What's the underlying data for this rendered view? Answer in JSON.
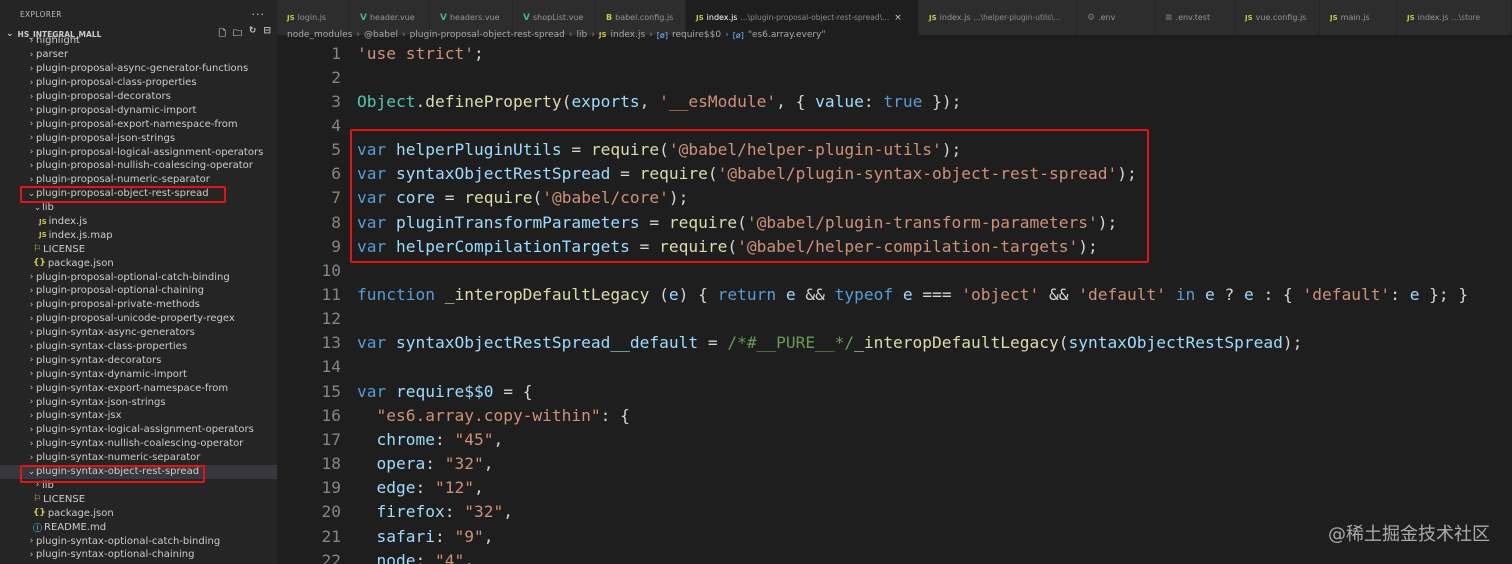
{
  "sidebar": {
    "title": "EXPLORER",
    "more": "···",
    "project": "HS_INTEGRAL_MALL",
    "items": [
      {
        "label": "highlight",
        "indent": 1,
        "chev": "›"
      },
      {
        "label": "parser",
        "indent": 1,
        "chev": "›"
      },
      {
        "label": "plugin-proposal-async-generator-functions",
        "indent": 1,
        "chev": "›"
      },
      {
        "label": "plugin-proposal-class-properties",
        "indent": 1,
        "chev": "›"
      },
      {
        "label": "plugin-proposal-decorators",
        "indent": 1,
        "chev": "›"
      },
      {
        "label": "plugin-proposal-dynamic-import",
        "indent": 1,
        "chev": "›"
      },
      {
        "label": "plugin-proposal-export-namespace-from",
        "indent": 1,
        "chev": "›"
      },
      {
        "label": "plugin-proposal-json-strings",
        "indent": 1,
        "chev": "›"
      },
      {
        "label": "plugin-proposal-logical-assignment-operators",
        "indent": 1,
        "chev": "›"
      },
      {
        "label": "plugin-proposal-nullish-coalescing-operator",
        "indent": 1,
        "chev": "›"
      },
      {
        "label": "plugin-proposal-numeric-separator",
        "indent": 1,
        "chev": "›"
      },
      {
        "label": "plugin-proposal-object-rest-spread",
        "indent": 1,
        "chev": "⌄"
      },
      {
        "label": "lib",
        "indent": 2,
        "chev": "⌄"
      },
      {
        "label": "index.js",
        "indent": 3,
        "icon": "JS"
      },
      {
        "label": "index.js.map",
        "indent": 3,
        "icon": "JS"
      },
      {
        "label": "LICENSE",
        "indent": 2,
        "icon": "LIC"
      },
      {
        "label": "package.json",
        "indent": 2,
        "icon": "JSON"
      },
      {
        "label": "plugin-proposal-optional-catch-binding",
        "indent": 1,
        "chev": "›"
      },
      {
        "label": "plugin-proposal-optional-chaining",
        "indent": 1,
        "chev": "›"
      },
      {
        "label": "plugin-proposal-private-methods",
        "indent": 1,
        "chev": "›"
      },
      {
        "label": "plugin-proposal-unicode-property-regex",
        "indent": 1,
        "chev": "›"
      },
      {
        "label": "plugin-syntax-async-generators",
        "indent": 1,
        "chev": "›"
      },
      {
        "label": "plugin-syntax-class-properties",
        "indent": 1,
        "chev": "›"
      },
      {
        "label": "plugin-syntax-decorators",
        "indent": 1,
        "chev": "›"
      },
      {
        "label": "plugin-syntax-dynamic-import",
        "indent": 1,
        "chev": "›"
      },
      {
        "label": "plugin-syntax-export-namespace-from",
        "indent": 1,
        "chev": "›"
      },
      {
        "label": "plugin-syntax-json-strings",
        "indent": 1,
        "chev": "›"
      },
      {
        "label": "plugin-syntax-jsx",
        "indent": 1,
        "chev": "›"
      },
      {
        "label": "plugin-syntax-logical-assignment-operators",
        "indent": 1,
        "chev": "›"
      },
      {
        "label": "plugin-syntax-nullish-coalescing-operator",
        "indent": 1,
        "chev": "›"
      },
      {
        "label": "plugin-syntax-numeric-separator",
        "indent": 1,
        "chev": "›"
      },
      {
        "label": "plugin-syntax-object-rest-spread",
        "indent": 1,
        "chev": "⌄",
        "selected": true
      },
      {
        "label": "lib",
        "indent": 2,
        "chev": "›"
      },
      {
        "label": "LICENSE",
        "indent": 2,
        "icon": "LIC"
      },
      {
        "label": "package.json",
        "indent": 2,
        "icon": "JSON"
      },
      {
        "label": "README.md",
        "indent": 2,
        "icon": "INFO"
      },
      {
        "label": "plugin-syntax-optional-catch-binding",
        "indent": 1,
        "chev": "›"
      },
      {
        "label": "plugin-syntax-optional-chaining",
        "indent": 1,
        "chev": "›"
      }
    ]
  },
  "tabs": [
    {
      "label": "login.js",
      "icon": "JS",
      "width": 73
    },
    {
      "label": "header.vue",
      "icon": "V",
      "width": 80
    },
    {
      "label": "headers.vue",
      "icon": "V",
      "width": 83
    },
    {
      "label": "shopList.vue",
      "icon": "V",
      "width": 83
    },
    {
      "label": "babel.config.js",
      "icon": "B",
      "width": 90
    },
    {
      "label": "index.js",
      "desc": "...\\plugin-proposal-object-rest-spread\\...",
      "icon": "JS",
      "active": true,
      "close": "×",
      "width": 233
    },
    {
      "label": "index.js",
      "desc": "...\\helper-plugin-utils\\...",
      "icon": "JS",
      "width": 158
    },
    {
      "label": ".env",
      "icon": "⚙",
      "width": 78
    },
    {
      "label": ".env.test",
      "icon": "≡",
      "width": 80
    },
    {
      "label": "vue.config.js",
      "icon": "JS",
      "width": 85
    },
    {
      "label": "main.js",
      "icon": "JS",
      "width": 77
    },
    {
      "label": "index.js",
      "desc": "...\\store",
      "icon": "JS",
      "width": 115
    }
  ],
  "breadcrumb": [
    "node_modules",
    "@babel",
    "plugin-proposal-object-rest-spread",
    "lib",
    "index.js",
    "require$$0",
    "\"es6.array.every\""
  ],
  "breadcrumb_icons": {
    "file": "JS",
    "symbol": "[ø]"
  },
  "watermark": "@稀土掘金技术社区",
  "code_lines": [
    {
      "n": "1",
      "tokens": [
        [
          "str",
          "'use strict'"
        ],
        [
          "",
          ";"
        ]
      ]
    },
    {
      "n": "2",
      "tokens": []
    },
    {
      "n": "3",
      "tokens": [
        [
          "cls",
          "Object"
        ],
        [
          "",
          "."
        ],
        [
          "fn",
          "defineProperty"
        ],
        [
          "",
          "("
        ],
        [
          "var",
          "exports"
        ],
        [
          "",
          ", "
        ],
        [
          "str",
          "'__esModule'"
        ],
        [
          "",
          ", { "
        ],
        [
          "var",
          "value"
        ],
        [
          "",
          ": "
        ],
        [
          "kw",
          "true"
        ],
        [
          "",
          " });"
        ]
      ]
    },
    {
      "n": "4",
      "tokens": []
    },
    {
      "n": "5",
      "tokens": [
        [
          "kw",
          "var"
        ],
        [
          "",
          " "
        ],
        [
          "var",
          "helperPluginUtils"
        ],
        [
          "",
          " = "
        ],
        [
          "fn",
          "require"
        ],
        [
          "",
          "("
        ],
        [
          "str",
          "'@babel/helper-plugin-utils'"
        ],
        [
          "",
          ");"
        ]
      ]
    },
    {
      "n": "6",
      "tokens": [
        [
          "kw",
          "var"
        ],
        [
          "",
          " "
        ],
        [
          "var",
          "syntaxObjectRestSpread"
        ],
        [
          "",
          " = "
        ],
        [
          "fn",
          "require"
        ],
        [
          "",
          "("
        ],
        [
          "str",
          "'@babel/plugin-syntax-object-rest-spread'"
        ],
        [
          "",
          ");"
        ]
      ]
    },
    {
      "n": "7",
      "tokens": [
        [
          "kw",
          "var"
        ],
        [
          "",
          " "
        ],
        [
          "var",
          "core"
        ],
        [
          "",
          " = "
        ],
        [
          "fn",
          "require"
        ],
        [
          "",
          "("
        ],
        [
          "str",
          "'@babel/core'"
        ],
        [
          "",
          ");"
        ]
      ]
    },
    {
      "n": "8",
      "tokens": [
        [
          "kw",
          "var"
        ],
        [
          "",
          " "
        ],
        [
          "var",
          "pluginTransformParameters"
        ],
        [
          "",
          " = "
        ],
        [
          "fn",
          "require"
        ],
        [
          "",
          "("
        ],
        [
          "str",
          "'@babel/plugin-transform-parameters'"
        ],
        [
          "",
          ");"
        ]
      ]
    },
    {
      "n": "9",
      "tokens": [
        [
          "kw",
          "var"
        ],
        [
          "",
          " "
        ],
        [
          "var",
          "helperCompilationTargets"
        ],
        [
          "",
          " = "
        ],
        [
          "fn",
          "require"
        ],
        [
          "",
          "("
        ],
        [
          "str",
          "'@babel/helper-compilation-targets'"
        ],
        [
          "",
          ");"
        ]
      ]
    },
    {
      "n": "10",
      "tokens": []
    },
    {
      "n": "11",
      "tokens": [
        [
          "kw",
          "function"
        ],
        [
          "",
          " "
        ],
        [
          "fn",
          "_interopDefaultLegacy"
        ],
        [
          "",
          " ("
        ],
        [
          "var",
          "e"
        ],
        [
          "",
          ") { "
        ],
        [
          "kw",
          "return"
        ],
        [
          "",
          " "
        ],
        [
          "var",
          "e"
        ],
        [
          "",
          " && "
        ],
        [
          "kw",
          "typeof"
        ],
        [
          "",
          " "
        ],
        [
          "var",
          "e"
        ],
        [
          "",
          " === "
        ],
        [
          "str",
          "'object'"
        ],
        [
          "",
          " && "
        ],
        [
          "str",
          "'default'"
        ],
        [
          "",
          " "
        ],
        [
          "kw",
          "in"
        ],
        [
          "",
          " "
        ],
        [
          "var",
          "e"
        ],
        [
          "",
          " ? "
        ],
        [
          "var",
          "e"
        ],
        [
          "",
          " : { "
        ],
        [
          "str",
          "'default'"
        ],
        [
          "",
          ": "
        ],
        [
          "var",
          "e"
        ],
        [
          "",
          " }; }"
        ]
      ]
    },
    {
      "n": "12",
      "tokens": []
    },
    {
      "n": "13",
      "tokens": [
        [
          "kw",
          "var"
        ],
        [
          "",
          " "
        ],
        [
          "var",
          "syntaxObjectRestSpread__default"
        ],
        [
          "",
          " = "
        ],
        [
          "cmt",
          "/*#__PURE__*/"
        ],
        [
          "fn",
          "_interopDefaultLegacy"
        ],
        [
          "",
          "("
        ],
        [
          "var",
          "syntaxObjectRestSpread"
        ],
        [
          "",
          ");"
        ]
      ]
    },
    {
      "n": "14",
      "tokens": []
    },
    {
      "n": "15",
      "tokens": [
        [
          "kw",
          "var"
        ],
        [
          "",
          " "
        ],
        [
          "var",
          "require$$0"
        ],
        [
          "",
          " = {"
        ]
      ]
    },
    {
      "n": "16",
      "tokens": [
        [
          "",
          "  "
        ],
        [
          "str",
          "\"es6.array.copy-within\""
        ],
        [
          "",
          ": {"
        ]
      ]
    },
    {
      "n": "17",
      "tokens": [
        [
          "",
          "  "
        ],
        [
          "var",
          "chrome"
        ],
        [
          "",
          ": "
        ],
        [
          "str",
          "\"45\""
        ],
        [
          "",
          ","
        ]
      ]
    },
    {
      "n": "18",
      "tokens": [
        [
          "",
          "  "
        ],
        [
          "var",
          "opera"
        ],
        [
          "",
          ": "
        ],
        [
          "str",
          "\"32\""
        ],
        [
          "",
          ","
        ]
      ]
    },
    {
      "n": "19",
      "tokens": [
        [
          "",
          "  "
        ],
        [
          "var",
          "edge"
        ],
        [
          "",
          ": "
        ],
        [
          "str",
          "\"12\""
        ],
        [
          "",
          ","
        ]
      ]
    },
    {
      "n": "20",
      "tokens": [
        [
          "",
          "  "
        ],
        [
          "var",
          "firefox"
        ],
        [
          "",
          ": "
        ],
        [
          "str",
          "\"32\""
        ],
        [
          "",
          ","
        ]
      ]
    },
    {
      "n": "21",
      "tokens": [
        [
          "",
          "  "
        ],
        [
          "var",
          "safari"
        ],
        [
          "",
          ": "
        ],
        [
          "str",
          "\"9\""
        ],
        [
          "",
          ","
        ]
      ]
    },
    {
      "n": "22",
      "tokens": [
        [
          "",
          "  "
        ],
        [
          "var",
          "node"
        ],
        [
          "",
          ": "
        ],
        [
          "str",
          "\"4\""
        ],
        [
          "",
          ","
        ]
      ]
    }
  ]
}
